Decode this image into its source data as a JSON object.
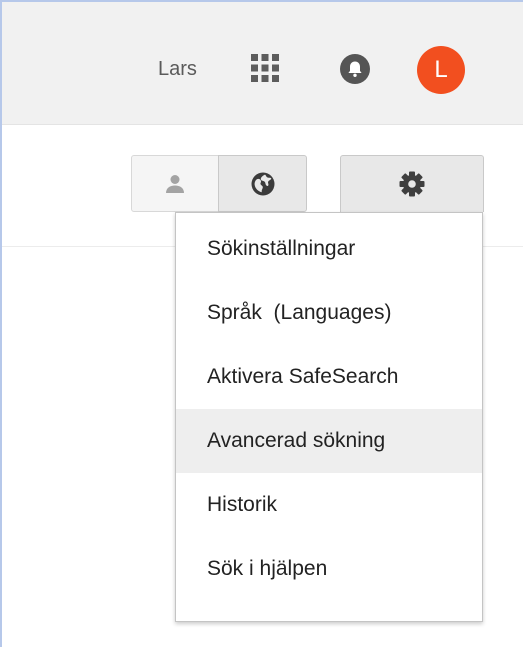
{
  "topbar": {
    "user_name": "Lars",
    "apps_icon": "apps-grid-icon",
    "notifications_icon": "notifications-bell-icon",
    "avatar_letter": "L",
    "avatar_color": "#f24f1f"
  },
  "toolbar": {
    "personal_results_icon": "person-icon",
    "global_results_icon": "globe-icon",
    "settings_icon": "gear-icon"
  },
  "settings_menu": {
    "items": [
      {
        "label": "Sökinställningar"
      },
      {
        "label": "Språk  (Languages)"
      },
      {
        "label": "Aktivera SafeSearch"
      },
      {
        "label": "Avancerad sökning",
        "highlighted": true
      },
      {
        "label": "Historik"
      },
      {
        "label": "Sök i hjälpen"
      }
    ]
  }
}
